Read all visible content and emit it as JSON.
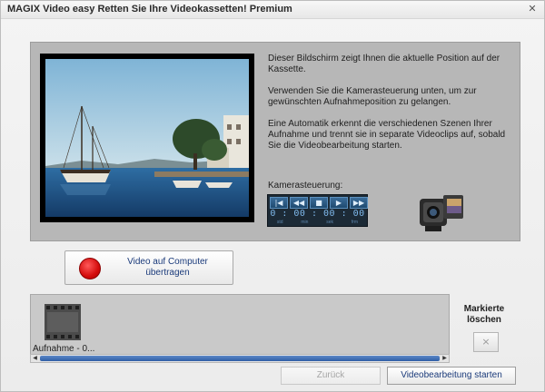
{
  "window": {
    "title": "MAGIX Video easy Retten Sie Ihre Videokassetten! Premium",
    "close_icon": "close-icon"
  },
  "preview": {
    "info_paragraphs": [
      "Dieser Bildschirm zeigt Ihnen die aktuelle Position auf der Kassette.",
      "Verwenden Sie die Kamerasteuerung unten, um zur gewünschten Aufnahmeposition zu gelangen.",
      "Eine Automatik erkennt die verschiedenen Szenen Ihrer Aufnahme und trennt sie in separate Videoclips auf, sobald Sie die Videobearbeitung starten."
    ],
    "camera_label": "Kamerasteuerung:",
    "transport": {
      "buttons": [
        "skip-start-icon",
        "rewind-icon",
        "stop-icon",
        "play-icon",
        "fast-forward-icon"
      ],
      "timecode": "0 : 00 : 00 : 00",
      "units": [
        "std",
        "min",
        "sek",
        "frm"
      ]
    }
  },
  "record": {
    "label_line1": "Video auf Computer",
    "label_line2": "übertragen"
  },
  "storyboard": {
    "clip_label": "Aufnahme - 0..."
  },
  "delete": {
    "label_line1": "Markierte",
    "label_line2": "löschen",
    "icon": "×"
  },
  "footer": {
    "back_label": "Zurück",
    "start_label": "Videobearbeitung starten"
  },
  "colors": {
    "accent_blue": "#2f5fa6",
    "record_red": "#d40c0c",
    "panel_gray": "#b7b7b7"
  }
}
